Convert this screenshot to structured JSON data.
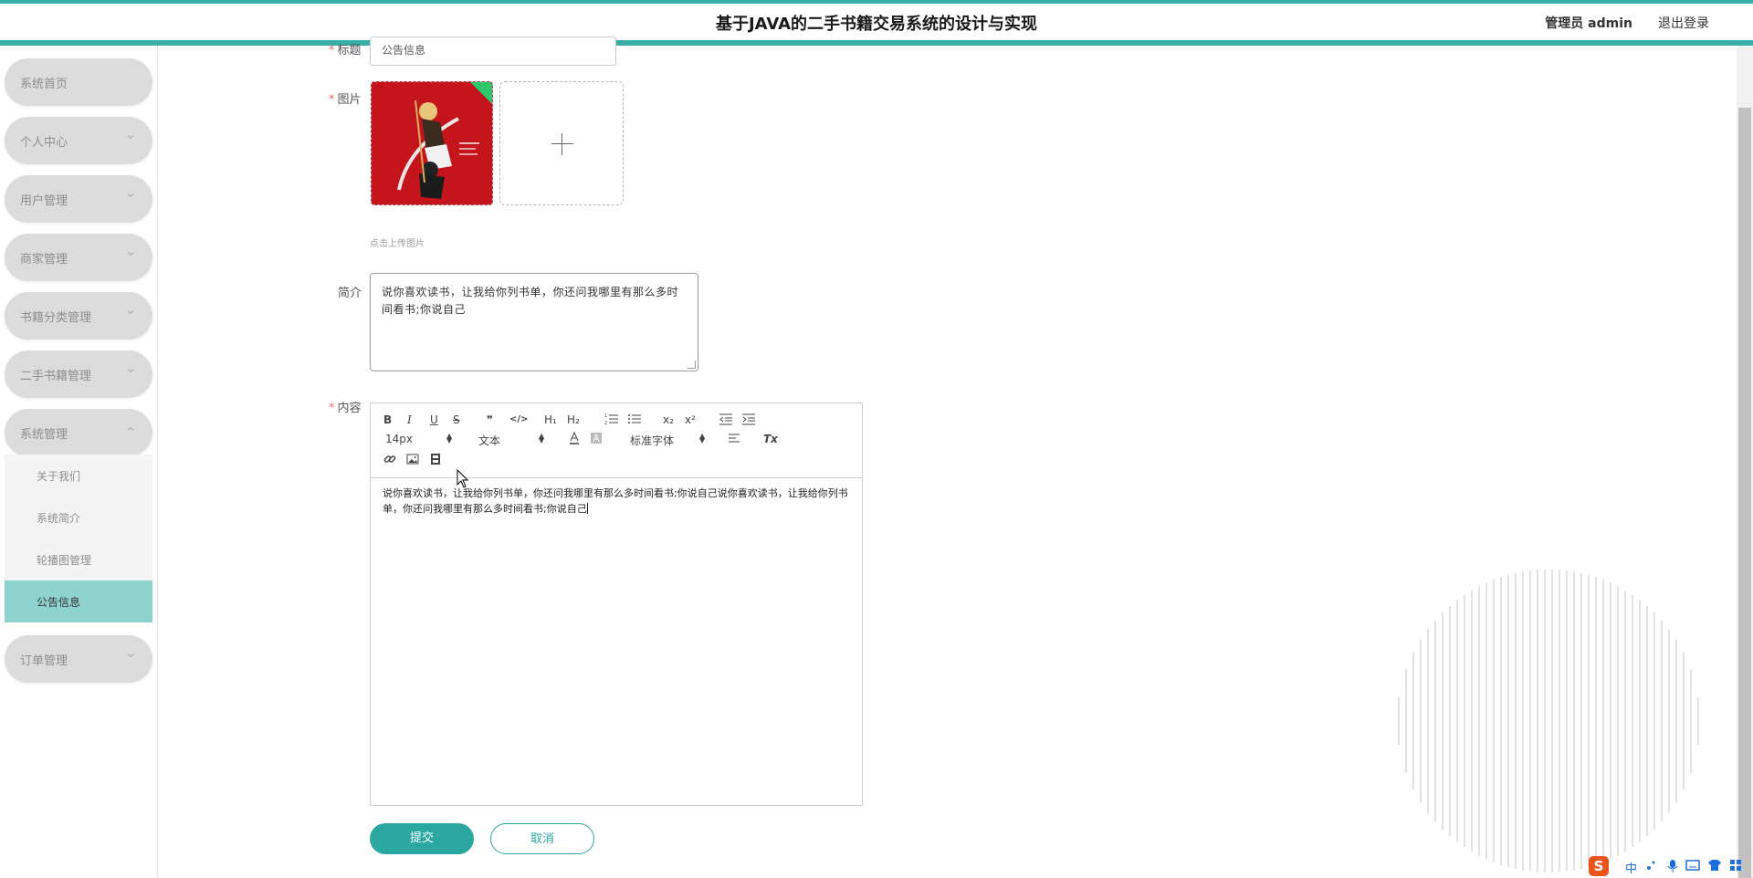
{
  "header": {
    "title": "基于JAVA的二手书籍交易系统的设计与实现",
    "user": "管理员 admin",
    "logout": "退出登录"
  },
  "sidebar": {
    "items": [
      {
        "label": "系统首页"
      },
      {
        "label": "个人中心"
      },
      {
        "label": "用户管理"
      },
      {
        "label": "商家管理"
      },
      {
        "label": "书籍分类管理"
      },
      {
        "label": "二手书籍管理"
      },
      {
        "label": "系统管理"
      },
      {
        "label": "订单管理"
      }
    ],
    "submenu": [
      {
        "label": "关于我们"
      },
      {
        "label": "系统简介"
      },
      {
        "label": "轮播图管理"
      },
      {
        "label": "公告信息"
      }
    ]
  },
  "form": {
    "title_label": "标题",
    "title_value": "公告信息",
    "image_label": "图片",
    "upload_tip": "点击上传图片",
    "intro_label": "简介",
    "intro_value": "说你喜欢读书，让我给你列书单，你还问我哪里有那么多时间看书;你说自己",
    "content_label": "内容",
    "required_mark": "*"
  },
  "editor": {
    "toolbar": {
      "bold": "B",
      "italic": "I",
      "underline": "U",
      "strike": "S",
      "quote": "❞",
      "code": "</>",
      "h1": "H₁",
      "h2": "H₂",
      "sub": "x₂",
      "sup": "x²",
      "size": "14px",
      "header": "文本",
      "font": "标准字体",
      "clear": "Tx"
    },
    "content": "说你喜欢读书，让我给你列书单，你还问我哪里有那么多时间看书;你说自己说你喜欢读书，让我给你列书单，你还问我哪里有那么多时间看书;你说自己"
  },
  "buttons": {
    "submit": "提交",
    "cancel": "取消"
  },
  "ime": {
    "logo": "S",
    "mode": "中"
  }
}
